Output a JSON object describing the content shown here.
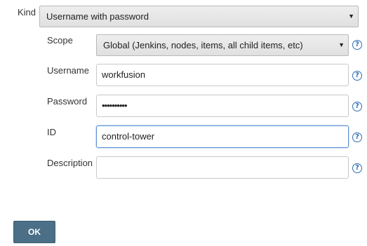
{
  "kind": {
    "label": "Kind",
    "value": "Username with password"
  },
  "scope": {
    "label": "Scope",
    "value": "Global (Jenkins, nodes, items, all child items, etc)"
  },
  "username": {
    "label": "Username",
    "value": "workfusion"
  },
  "password": {
    "label": "Password",
    "value": "••••••••••"
  },
  "id": {
    "label": "ID",
    "value": "control-tower"
  },
  "description": {
    "label": "Description",
    "value": ""
  },
  "help_glyph": "?",
  "dropdown_arrow": "▼",
  "ok_button": {
    "label": "OK"
  },
  "colors": {
    "ok_button_bg": "#4a6f86",
    "help_icon": "#2f6cb3",
    "focus_border": "#5b8fcf"
  }
}
